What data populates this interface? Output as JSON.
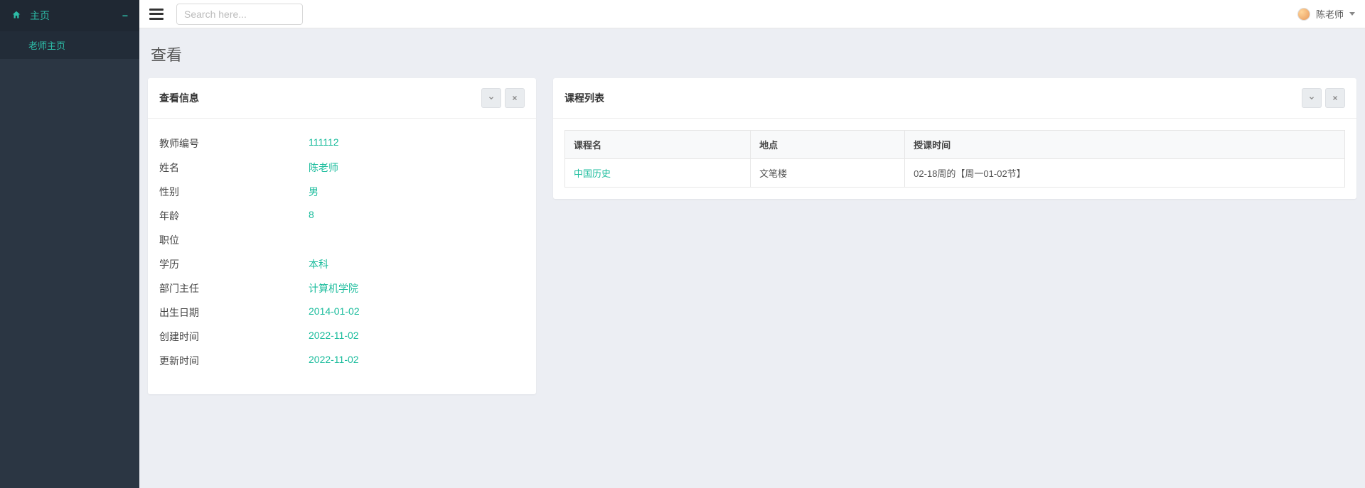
{
  "sidebar": {
    "home_label": "主页",
    "sub_label": "老师主页"
  },
  "topbar": {
    "search_placeholder": "Search here...",
    "username": "陈老师"
  },
  "page": {
    "title": "查看"
  },
  "info_panel": {
    "title": "查看信息",
    "rows": [
      {
        "label": "教师编号",
        "value": "111112"
      },
      {
        "label": "姓名",
        "value": "陈老师"
      },
      {
        "label": "性别",
        "value": "男"
      },
      {
        "label": "年龄",
        "value": "8"
      },
      {
        "label": "职位",
        "value": ""
      },
      {
        "label": "学历",
        "value": "本科"
      },
      {
        "label": "部门主任",
        "value": "计算机学院"
      },
      {
        "label": "出生日期",
        "value": "2014-01-02"
      },
      {
        "label": "创建时间",
        "value": "2022-11-02"
      },
      {
        "label": "更新时间",
        "value": "2022-11-02"
      }
    ]
  },
  "course_panel": {
    "title": "课程列表",
    "headers": [
      "课程名",
      "地点",
      "授课时间"
    ],
    "rows": [
      {
        "name": "中国历史",
        "location": "文笔楼",
        "time": "02-18周的【周一01-02节】"
      }
    ]
  }
}
